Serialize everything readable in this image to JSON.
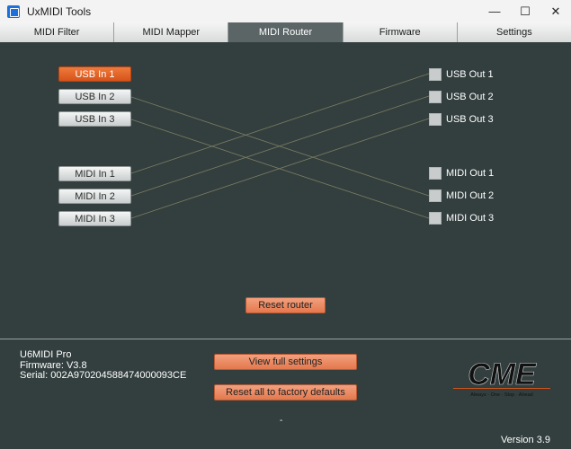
{
  "window": {
    "title": "UxMIDI Tools",
    "controls": {
      "minimize": "—",
      "maximize": "☐",
      "close": "✕"
    }
  },
  "tabs": [
    {
      "label": "MIDI Filter",
      "active": false
    },
    {
      "label": "MIDI Mapper",
      "active": false
    },
    {
      "label": "MIDI Router",
      "active": true
    },
    {
      "label": "Firmware",
      "active": false
    },
    {
      "label": "Settings",
      "active": false
    }
  ],
  "router": {
    "inputs": [
      {
        "label": "USB In 1",
        "selected": true
      },
      {
        "label": "USB In 2",
        "selected": false
      },
      {
        "label": "USB In 3",
        "selected": false
      },
      {
        "label": "MIDI In 1",
        "selected": false
      },
      {
        "label": "MIDI In 2",
        "selected": false
      },
      {
        "label": "MIDI In 3",
        "selected": false
      }
    ],
    "outputs": [
      {
        "label": "USB Out 1",
        "checked": false
      },
      {
        "label": "USB Out 2",
        "checked": false
      },
      {
        "label": "USB Out 3",
        "checked": false
      },
      {
        "label": "MIDI Out 1",
        "checked": false
      },
      {
        "label": "MIDI Out 2",
        "checked": false
      },
      {
        "label": "MIDI Out 3",
        "checked": false
      }
    ],
    "routes": [
      {
        "from": "USB In 2",
        "to": "MIDI Out 2"
      },
      {
        "from": "USB In 3",
        "to": "MIDI Out 3"
      },
      {
        "from": "MIDI In 1",
        "to": "USB Out 1"
      },
      {
        "from": "MIDI In 2",
        "to": "USB Out 2"
      },
      {
        "from": "MIDI In 3",
        "to": "USB Out 3"
      }
    ],
    "reset_label": "Reset router"
  },
  "device": {
    "name": "U6MIDI Pro",
    "firmware": "Firmware: V3.8",
    "serial": "Serial: 002A970204588474000093CE"
  },
  "actions": {
    "view_full_settings": "View full settings",
    "factory_reset": "Reset all to factory defaults"
  },
  "logo": {
    "text": "CME",
    "tagline": [
      "Always",
      "One",
      "Stop",
      "Ahead"
    ]
  },
  "status_dash": "-",
  "version": "Version 3.9",
  "colors": {
    "background": "#333e3e",
    "accent_active": "#e15a1d",
    "orange_button": "#e88a62",
    "route_line": "#7b7d63"
  }
}
